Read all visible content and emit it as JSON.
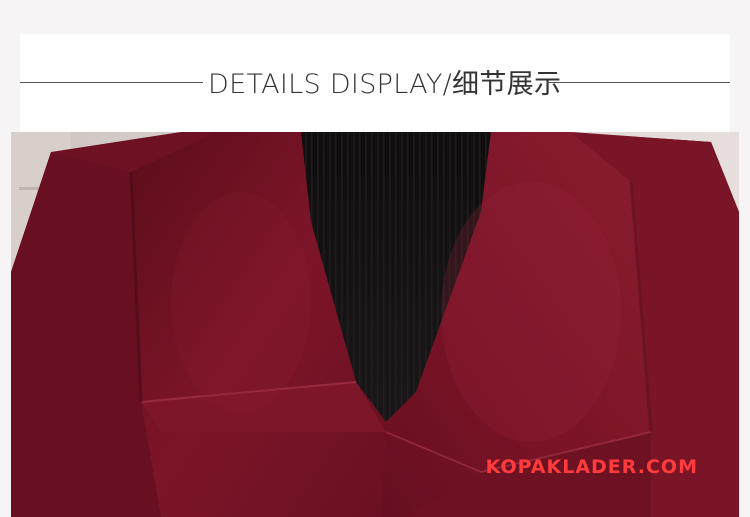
{
  "header": {
    "title": "DETAILS DISPLAY/细节展示"
  },
  "photo": {
    "subject": "coat-collar-detail",
    "colors": {
      "coat": "#7a1326",
      "coat_shadow": "#4e0a17",
      "sweater": "#141213",
      "background": "#d9d2cf"
    }
  },
  "watermark": {
    "text": "KOPAKLADER.COM",
    "color": "#ff3b3b"
  }
}
